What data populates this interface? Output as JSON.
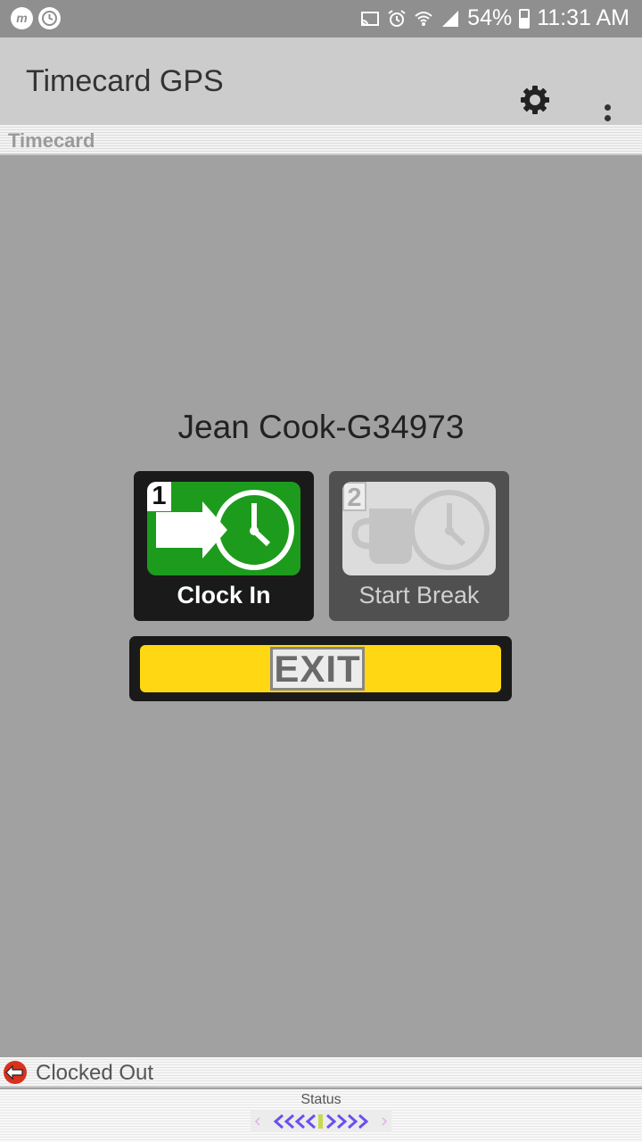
{
  "status_bar": {
    "battery": "54%",
    "time": "11:31 AM"
  },
  "app_bar": {
    "title": "Timecard GPS"
  },
  "section": {
    "label": "Timecard"
  },
  "main": {
    "user_name": "Jean Cook-G34973",
    "clock_in": {
      "number": "1",
      "label": "Clock In"
    },
    "start_break": {
      "number": "2",
      "label": "Start Break"
    },
    "exit": {
      "label": "EXIT"
    }
  },
  "clock_status": {
    "text": "Clocked Out"
  },
  "footer": {
    "label": "Status"
  },
  "colors": {
    "green": "#1d9b1d",
    "yellow": "#ffd813",
    "background": "#a0a1a0",
    "progress_purple": "#6a4ff0"
  }
}
